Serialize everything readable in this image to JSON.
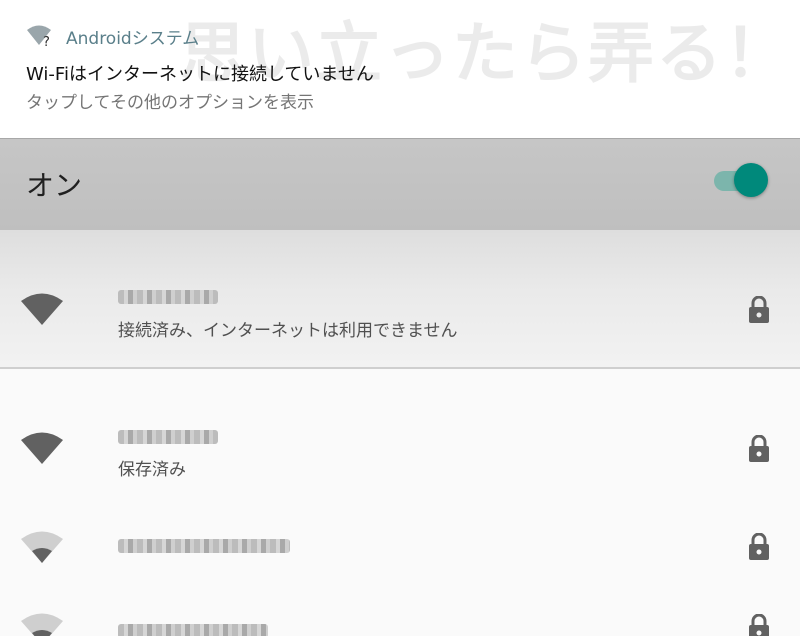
{
  "notification": {
    "app_name": "Androidシステム",
    "title": "Wi-Fiはインターネットに接続していません",
    "subtitle": "タップしてその他のオプションを表示",
    "watermark": "思い立ったら弄る！",
    "icon": "wifi-question-icon"
  },
  "wifi_toggle": {
    "label": "オン",
    "state": "on",
    "color": "#00897b"
  },
  "networks": [
    {
      "status": "接続済み、インターネットは利用できません",
      "signal": "full",
      "secured": true,
      "icon": "wifi-full-icon"
    },
    {
      "status": "保存済み",
      "signal": "full",
      "secured": true,
      "icon": "wifi-full-icon"
    },
    {
      "status": "",
      "signal": "weak",
      "secured": true,
      "icon": "wifi-weak-icon"
    },
    {
      "status": "",
      "signal": "weak",
      "secured": true,
      "icon": "wifi-weak-icon"
    }
  ]
}
